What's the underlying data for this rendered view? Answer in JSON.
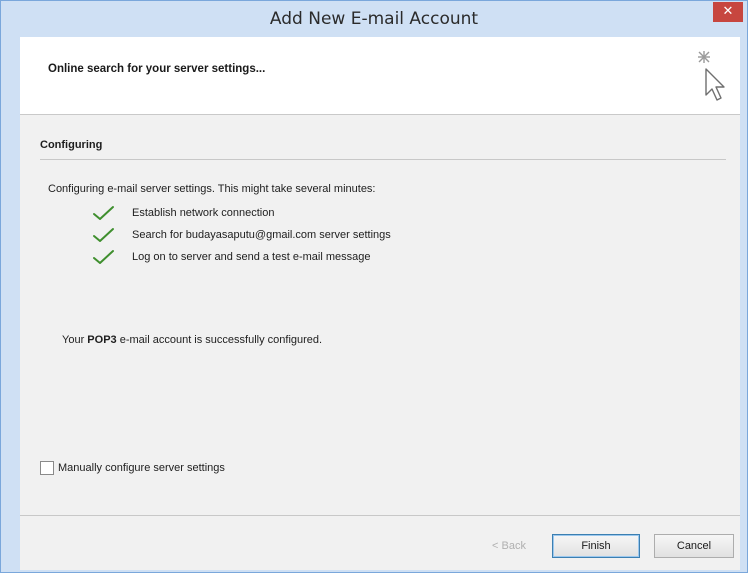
{
  "window": {
    "title": "Add New E-mail Account",
    "close_symbol": "✕"
  },
  "header": {
    "title": "Online search for your server settings...",
    "icon": "cursor-sparkle-icon"
  },
  "section": {
    "title": "Configuring",
    "intro": "Configuring e-mail server settings. This might take several minutes:",
    "steps": [
      {
        "label": "Establish network connection",
        "status": "done"
      },
      {
        "label": "Search for budayasaputu@gmail.com server settings",
        "status": "done"
      },
      {
        "label": "Log on to server and send a test e-mail message",
        "status": "done"
      }
    ],
    "result": {
      "prefix": "Your ",
      "protocol": "POP3",
      "suffix": " e-mail account is successfully configured."
    }
  },
  "manual_config": {
    "label": "Manually configure server settings",
    "checked": false
  },
  "buttons": {
    "back": "< Back",
    "finish": "Finish",
    "cancel": "Cancel"
  },
  "colors": {
    "title_bar": "#cfe0f4",
    "close_button": "#c7463f",
    "check": "#3f8f2e"
  }
}
